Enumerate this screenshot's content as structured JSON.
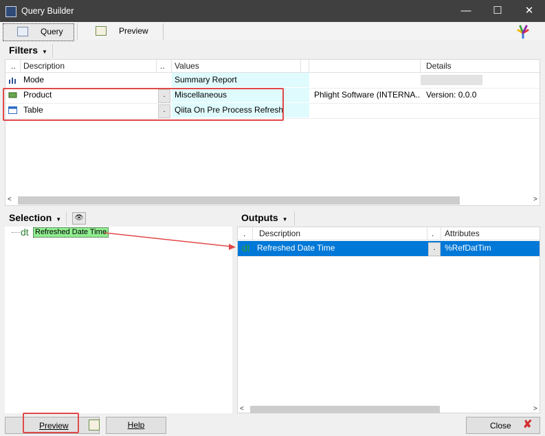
{
  "window": {
    "title": "Query Builder",
    "controls": [
      "—",
      "☐",
      "✕"
    ]
  },
  "tabs": [
    {
      "label": "Query"
    },
    {
      "label": "Preview"
    }
  ],
  "filters": {
    "header": "Filters",
    "columns": [
      "..",
      "Description",
      "..",
      "Values",
      "Details"
    ],
    "rows": [
      {
        "description": "Mode",
        "value": "Summary Report",
        "extra": "",
        "details": ""
      },
      {
        "description": "Product",
        "value": "Miscellaneous",
        "extra": "Phlight Software (INTERNA...",
        "details": "Version: 0.0.0"
      },
      {
        "description": "Table",
        "value": "Qiita On Pre Process Refresh",
        "extra": "",
        "details": ""
      }
    ]
  },
  "selection": {
    "header": "Selection",
    "items": [
      {
        "prefix": "dt",
        "label": "Refreshed Date Time"
      }
    ]
  },
  "outputs": {
    "header": "Outputs",
    "columns": [
      ".",
      "Description",
      ".",
      "Attributes"
    ],
    "rows": [
      {
        "prefix": "dt",
        "description": "Refreshed Date Time",
        "attribute": "%RefDatTim"
      }
    ]
  },
  "buttons": {
    "preview": "Preview",
    "help": "Help",
    "close": "Close"
  },
  "colors": {
    "titlebar": "#404040",
    "selected_row": "#0078d7",
    "value_cell": "#e0fbfd",
    "highlight_item": "#90ee90",
    "annotation_red": "#e04848"
  }
}
